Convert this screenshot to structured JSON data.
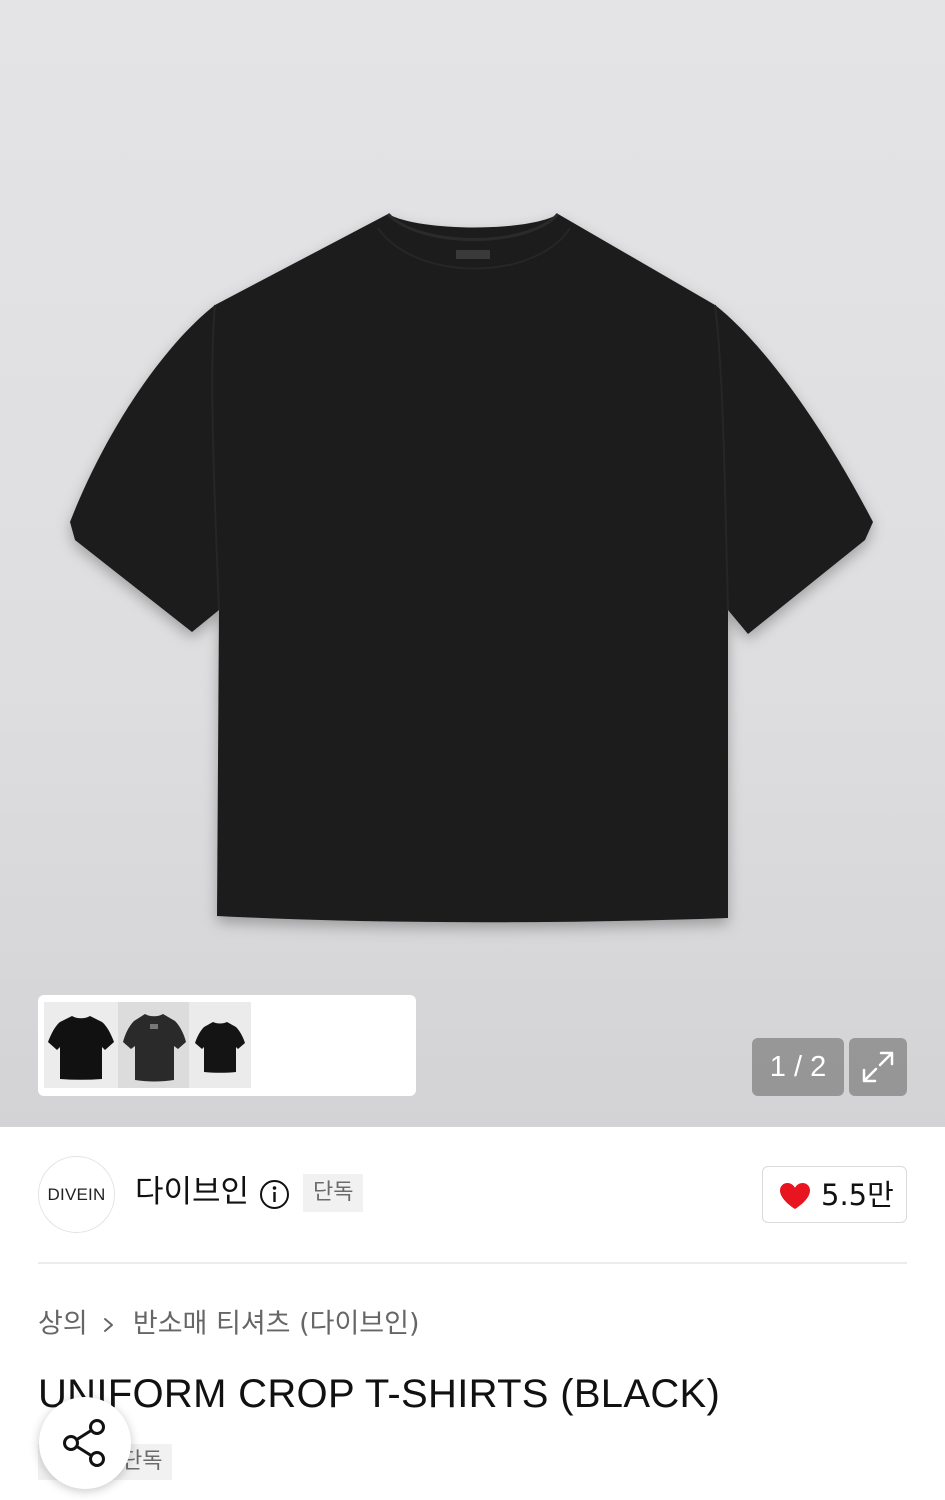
{
  "gallery": {
    "pager_current": "1",
    "pager_separator": "/",
    "pager_total": "2",
    "pager_text": "1 / 2",
    "thumbnail_count": 3,
    "expand_icon": "expand-icon"
  },
  "brand": {
    "logo_text": "DIVEIN",
    "name": "다이브인",
    "info_icon": "info-icon",
    "tag": "단독"
  },
  "like": {
    "icon": "heart-icon",
    "count": "5.5만",
    "color": "#e8141f"
  },
  "breadcrumb": {
    "category": "상의",
    "separator_icon": "chevron-right-icon",
    "subcategory": "반소매 티셔츠 (다이브인)"
  },
  "product": {
    "title": "UNIFORM CROP T-SHIRTS (BLACK)",
    "tag": "단독",
    "color": "#1a1a1a"
  },
  "share": {
    "icon": "share-icon"
  }
}
